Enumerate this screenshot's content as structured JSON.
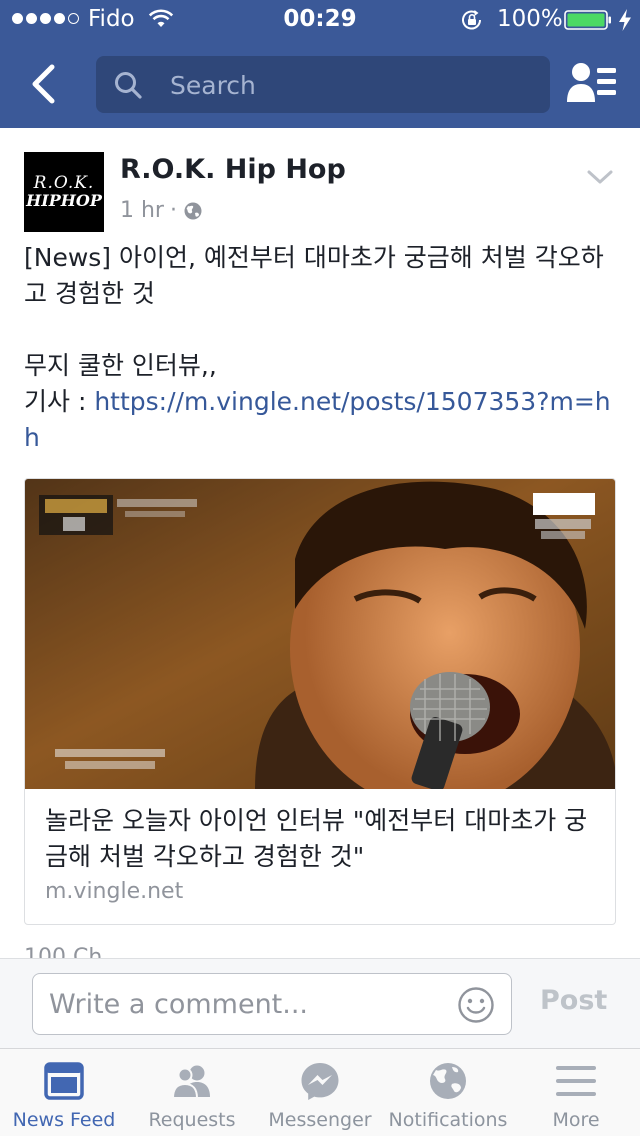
{
  "status_bar": {
    "carrier": "Fido",
    "time": "00:29",
    "battery_percent": "100%",
    "signal_bars_filled": 4,
    "signal_bars_total": 5
  },
  "header": {
    "search_placeholder": "Search",
    "back_icon": "chevron-left-icon",
    "friends_icon": "friends-list-icon"
  },
  "post": {
    "page_name": "R.O.K. Hip Hop",
    "avatar_text_line1": "R.O.K.",
    "avatar_text_line2": "HIPHOP",
    "time": "1 hr",
    "separator": "·",
    "text_line1": "[News] 아이언, 예전부터 대마초가 궁금해 처벌 각오하고 경험한 것",
    "text_line2": "무지 쿨한 인터뷰,,",
    "text_line3_prefix": "기사 : ",
    "link_url": "https://m.vingle.net/posts/1507353?m=hh",
    "link_card": {
      "title": "놀라운 오늘자 아이언 인터뷰 \"예전부터 대마초가 궁금해 처벌 각오하고 경험한 것\"",
      "domain": "m.vingle.net"
    },
    "reaction_count_partial": "100 Ch..."
  },
  "comment_bar": {
    "placeholder": "Write a comment...",
    "post_label": "Post"
  },
  "tab_bar": {
    "tabs": [
      {
        "label": "News Feed",
        "icon": "news-feed-icon",
        "active": true
      },
      {
        "label": "Requests",
        "icon": "friend-requests-icon",
        "active": false
      },
      {
        "label": "Messenger",
        "icon": "messenger-icon",
        "active": false
      },
      {
        "label": "Notifications",
        "icon": "globe-icon",
        "active": false
      },
      {
        "label": "More",
        "icon": "menu-icon",
        "active": false
      }
    ]
  },
  "colors": {
    "brand_blue": "#3b5998",
    "search_bg": "#2f4779",
    "link_blue": "#365899",
    "active_tab": "#4267b2",
    "battery_green": "#4cd964"
  }
}
